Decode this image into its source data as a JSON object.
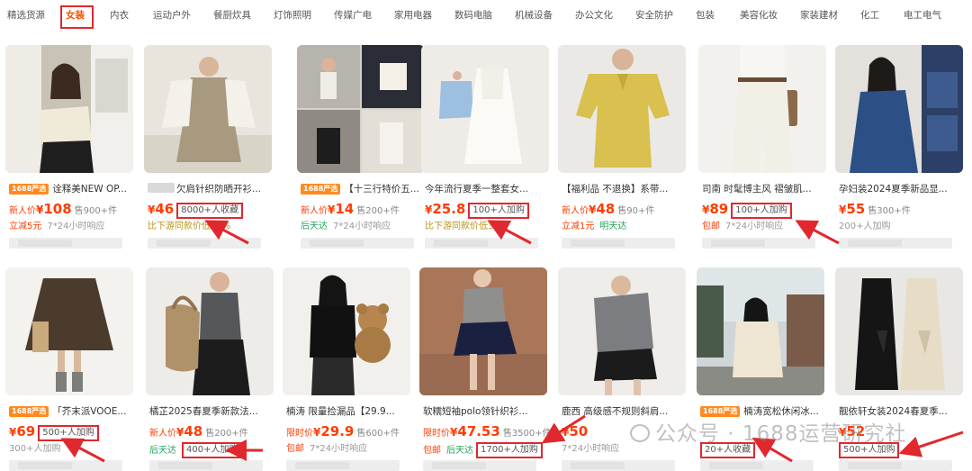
{
  "categories": [
    {
      "label": "精选货源",
      "active": false
    },
    {
      "label": "女装",
      "active": true
    },
    {
      "label": "内衣",
      "active": false
    },
    {
      "label": "运动户外",
      "active": false
    },
    {
      "label": "餐厨炊具",
      "active": false
    },
    {
      "label": "灯饰照明",
      "active": false
    },
    {
      "label": "传媒广电",
      "active": false
    },
    {
      "label": "家用电器",
      "active": false
    },
    {
      "label": "数码电脑",
      "active": false
    },
    {
      "label": "机械设备",
      "active": false
    },
    {
      "label": "办公文化",
      "active": false
    },
    {
      "label": "安全防护",
      "active": false
    },
    {
      "label": "包装",
      "active": false
    },
    {
      "label": "美容化妆",
      "active": false
    },
    {
      "label": "家装建材",
      "active": false
    },
    {
      "label": "化工",
      "active": false
    },
    {
      "label": "电工电气",
      "active": false
    }
  ],
  "products": [
    {
      "badge": "1688严选",
      "title": "诠释美NEW OP...",
      "label": "新人价",
      "currency": "¥",
      "price": "108",
      "sold": "售900+件",
      "tag": "",
      "highlight": "立减5元",
      "highlight_style": "red",
      "highlight2": "7*24小时响应"
    },
    {
      "badge": "",
      "title": "欠肩针织防晒开衫...",
      "label": "",
      "currency": "¥",
      "price": "46",
      "sold": "",
      "tag": "8000+人收藏",
      "highlight": "比下游同款价低35%",
      "highlight_style": "olive",
      "highlight2": ""
    },
    {
      "badge": "1688严选",
      "title": "【十三行特价五...",
      "label": "新人价",
      "currency": "¥",
      "price": "14",
      "sold": "售200+件",
      "tag": "",
      "highlight": "后天达",
      "highlight_style": "green",
      "highlight2": "7*24小时响应"
    },
    {
      "badge": "",
      "title": "今年流行夏季一整套女...",
      "label": "",
      "currency": "¥",
      "price": "25.8",
      "sold": "",
      "tag": "100+人加购",
      "highlight": "比下游同款价低33%",
      "highlight_style": "olive",
      "highlight2": ""
    },
    {
      "badge": "",
      "title": "【福利品 不退换】系带...",
      "label": "新人价",
      "currency": "¥",
      "price": "48",
      "sold": "售90+件",
      "tag": "",
      "highlight": "立减1元",
      "highlight_style": "red",
      "highlight2": "明天达"
    },
    {
      "badge": "",
      "title": "司南 时髦博主风 褶皱肌...",
      "label": "",
      "currency": "¥",
      "price": "89",
      "sold": "",
      "tag": "100+人加购",
      "highlight": "包邮",
      "highlight_style": "red",
      "highlight2": "7*24小时响应"
    },
    {
      "badge": "",
      "title": "孕妇装2024夏季新品显...",
      "label": "",
      "currency": "¥",
      "price": "55",
      "sold": "售300+件",
      "tag": "",
      "highlight": "200+人加购",
      "highlight_style": "gray",
      "highlight2": ""
    },
    {
      "badge": "1688严选",
      "title": "「芥末派VOOE...",
      "label": "",
      "currency": "¥",
      "price": "69",
      "sold": "",
      "tag": "500+人加购",
      "highlight": "300+人加购",
      "highlight_style": "gray",
      "highlight2": ""
    },
    {
      "badge": "",
      "title": "橘芷2025春夏季新款法...",
      "label": "新人价",
      "currency": "¥",
      "price": "48",
      "sold": "售200+件",
      "tag": "",
      "highlight": "后天达",
      "highlight_style": "green",
      "highlight2": "400+人加购"
    },
    {
      "badge": "",
      "title": "楠涛 限量捡漏品【29.9...",
      "label": "限时价",
      "currency": "¥",
      "price": "29.9",
      "sold": "售600+件",
      "tag": "",
      "highlight": "包邮",
      "highlight_style": "red",
      "highlight2": "7*24小时响应"
    },
    {
      "badge": "",
      "title": "软糯短袖polo领针织衫...",
      "label": "限时价",
      "currency": "¥",
      "price": "47.53",
      "sold": "售3500+件",
      "tag": "",
      "highlight": "包邮",
      "highlight_style": "red",
      "highlight2": "后天达",
      "highlight3": "1700+人加购"
    },
    {
      "badge": "",
      "title": "鹿西 高级感不规则斜肩...",
      "label": "",
      "currency": "¥",
      "price": "50",
      "sold": "",
      "tag": "",
      "highlight": "7*24小时响应",
      "highlight_style": "gray",
      "highlight2": ""
    },
    {
      "badge": "1688严选",
      "title": "楠涛宽松休闲冰...",
      "label": "",
      "currency": "",
      "price": "",
      "sold": "",
      "tag": "",
      "highlight": "20+人收藏",
      "highlight_style": "gray",
      "highlight2": ""
    },
    {
      "badge": "",
      "title": "靓依轩女装2024春夏季...",
      "label": "",
      "currency": "¥",
      "price": "52",
      "sold": "",
      "tag": "",
      "highlight": "500+人加购",
      "highlight_style": "gray",
      "highlight2": ""
    }
  ],
  "watermark": "公众号 · 1688运营研究社",
  "colors": {
    "accent": "#ff3c00",
    "highlight_box": "#e0282e",
    "green": "#27a35a"
  }
}
